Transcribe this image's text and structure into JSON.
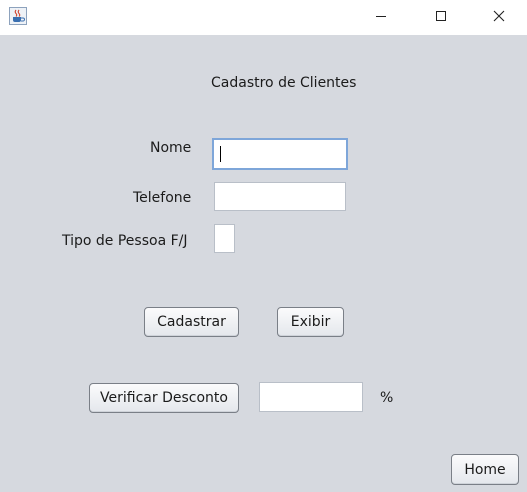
{
  "window": {
    "app_icon": "java-cup-icon",
    "controls": [
      "minimize-icon",
      "maximize-icon",
      "close-icon"
    ]
  },
  "form": {
    "heading": "Cadastro de Clientes",
    "fields": {
      "nome_label": "Nome",
      "nome_value": "",
      "telefone_label": "Telefone",
      "telefone_value": "",
      "tipo_label": "Tipo de Pessoa F/J",
      "tipo_value": ""
    },
    "buttons": {
      "cadastrar": "Cadastrar",
      "exibir": "Exibir",
      "verificar_desconto": "Verificar Desconto",
      "home": "Home"
    },
    "desconto_value": "",
    "percent_symbol": "%"
  },
  "colors": {
    "background": "#d6d9df",
    "titlebar": "#ffffff",
    "focus_border": "#7ea6d9"
  }
}
